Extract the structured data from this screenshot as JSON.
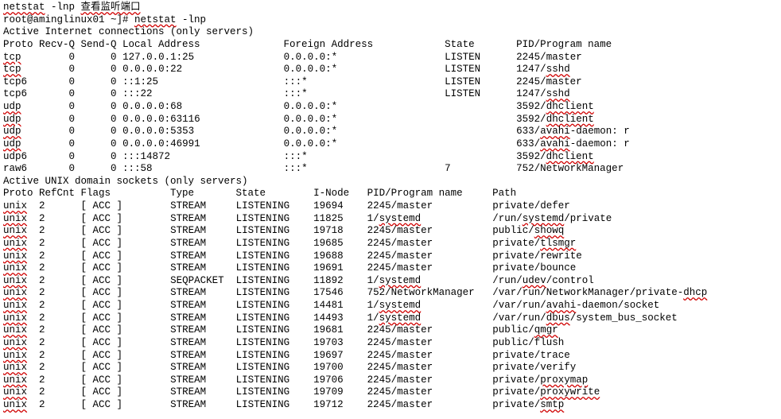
{
  "top_line_prefix": "netstat",
  "top_line_cmd": " -lnp ",
  "top_line_cn": "查看监听端口",
  "prompt_prefix": "root@aminglinux01 ~]# ",
  "prompt_cmd_prefix": "netstat",
  "prompt_cmd_rest": " -lnp",
  "inet_header": "Active Internet connections (only servers)",
  "inet_cols": {
    "proto": "Proto",
    "recvq": "Recv-Q",
    "sendq": "Send-Q",
    "local": "Local Address",
    "foreign": "Foreign Address",
    "state": "State",
    "pidprog": "PID/Program name"
  },
  "inet_rows": [
    {
      "proto": "tcp",
      "proto_err": true,
      "recvq": "0",
      "sendq": "0",
      "local": "127.0.0.1:25",
      "foreign": "0.0.0.0:*",
      "state": "LISTEN",
      "pid": "2245/",
      "prog": "master",
      "prog_err": false
    },
    {
      "proto": "tcp",
      "proto_err": true,
      "recvq": "0",
      "sendq": "0",
      "local": "0.0.0.0:22",
      "foreign": "0.0.0.0:*",
      "state": "LISTEN",
      "pid": "1247/",
      "prog": "sshd",
      "prog_err": true
    },
    {
      "proto": "tcp6",
      "proto_err": false,
      "recvq": "0",
      "sendq": "0",
      "local": "::1:25",
      "foreign": ":::*",
      "state": "LISTEN",
      "pid": "2245/",
      "prog": "master",
      "prog_err": false
    },
    {
      "proto": "tcp6",
      "proto_err": false,
      "recvq": "0",
      "sendq": "0",
      "local": ":::22",
      "foreign": ":::*",
      "state": "LISTEN",
      "pid": "1247/",
      "prog": "sshd",
      "prog_err": true
    },
    {
      "proto": "udp",
      "proto_err": true,
      "recvq": "0",
      "sendq": "0",
      "local": "0.0.0.0:68",
      "foreign": "0.0.0.0:*",
      "state": "",
      "pid": "3592/",
      "prog": "dhclient",
      "prog_err": true
    },
    {
      "proto": "udp",
      "proto_err": true,
      "recvq": "0",
      "sendq": "0",
      "local": "0.0.0.0:63116",
      "foreign": "0.0.0.0:*",
      "state": "",
      "pid": "3592/",
      "prog": "dhclient",
      "prog_err": true
    },
    {
      "proto": "udp",
      "proto_err": true,
      "recvq": "0",
      "sendq": "0",
      "local": "0.0.0.0:5353",
      "foreign": "0.0.0.0:*",
      "state": "",
      "pid": "633/",
      "prog": "avahi",
      "prog_err": true,
      "prog_rest": "-daemon: r"
    },
    {
      "proto": "udp",
      "proto_err": true,
      "recvq": "0",
      "sendq": "0",
      "local": "0.0.0.0:46991",
      "foreign": "0.0.0.0:*",
      "state": "",
      "pid": "633/",
      "prog": "avahi",
      "prog_err": true,
      "prog_rest": "-daemon: r"
    },
    {
      "proto": "udp6",
      "proto_err": false,
      "recvq": "0",
      "sendq": "0",
      "local": ":::14872",
      "foreign": ":::*",
      "state": "",
      "pid": "3592/",
      "prog": "dhclient",
      "prog_err": true
    },
    {
      "proto": "raw6",
      "proto_err": false,
      "recvq": "0",
      "sendq": "0",
      "local": ":::58",
      "foreign": ":::*",
      "state": "7",
      "pid": "752/",
      "prog": "NetworkManager",
      "prog_err": false
    }
  ],
  "unix_header": "Active UNIX domain sockets (only servers)",
  "unix_cols": {
    "proto": "Proto",
    "refcnt": "RefCnt",
    "flags": "Flags",
    "type": "Type",
    "state": "State",
    "inode": "I-Node",
    "pidprog": "PID/Program name",
    "path": "Path"
  },
  "unix_rows": [
    {
      "proto": "unix",
      "refcnt": "2",
      "flags": "[ ACC ]",
      "type": "STREAM",
      "state": "LISTENING",
      "inode": "19694",
      "pid": "2245/",
      "prog": "master",
      "prog_err": false,
      "path_pre": "private/",
      "path_tok": "defer",
      "path_err": false,
      "path_post": ""
    },
    {
      "proto": "unix",
      "refcnt": "2",
      "flags": "[ ACC ]",
      "type": "STREAM",
      "state": "LISTENING",
      "inode": "11825",
      "pid": "1/",
      "prog": "systemd",
      "prog_err": true,
      "path_pre": "/run/",
      "path_tok": "systemd",
      "path_err": true,
      "path_post": "/private"
    },
    {
      "proto": "unix",
      "refcnt": "2",
      "flags": "[ ACC ]",
      "type": "STREAM",
      "state": "LISTENING",
      "inode": "19718",
      "pid": "2245/",
      "prog": "master",
      "prog_err": false,
      "path_pre": "public/",
      "path_tok": "showq",
      "path_err": true,
      "path_post": ""
    },
    {
      "proto": "unix",
      "refcnt": "2",
      "flags": "[ ACC ]",
      "type": "STREAM",
      "state": "LISTENING",
      "inode": "19685",
      "pid": "2245/",
      "prog": "master",
      "prog_err": false,
      "path_pre": "private/",
      "path_tok": "tlsmgr",
      "path_err": true,
      "path_post": ""
    },
    {
      "proto": "unix",
      "refcnt": "2",
      "flags": "[ ACC ]",
      "type": "STREAM",
      "state": "LISTENING",
      "inode": "19688",
      "pid": "2245/",
      "prog": "master",
      "prog_err": false,
      "path_pre": "private/",
      "path_tok": "rewrite",
      "path_err": false,
      "path_post": ""
    },
    {
      "proto": "unix",
      "refcnt": "2",
      "flags": "[ ACC ]",
      "type": "STREAM",
      "state": "LISTENING",
      "inode": "19691",
      "pid": "2245/",
      "prog": "master",
      "prog_err": false,
      "path_pre": "private/",
      "path_tok": "bounce",
      "path_err": false,
      "path_post": ""
    },
    {
      "proto": "unix",
      "refcnt": "2",
      "flags": "[ ACC ]",
      "type": "SEQPACKET",
      "state": "LISTENING",
      "inode": "11892",
      "pid": "1/",
      "prog": "systemd",
      "prog_err": true,
      "path_pre": "/run/",
      "path_tok": "udev",
      "path_err": true,
      "path_post": "/control"
    },
    {
      "proto": "unix",
      "refcnt": "2",
      "flags": "[ ACC ]",
      "type": "STREAM",
      "state": "LISTENING",
      "inode": "17546",
      "pid": "752/",
      "prog": "NetworkManager",
      "prog_err": false,
      "path_pre": "/var/run/NetworkManager/private-",
      "path_tok": "dhcp",
      "path_err": true,
      "path_post": ""
    },
    {
      "proto": "unix",
      "refcnt": "2",
      "flags": "[ ACC ]",
      "type": "STREAM",
      "state": "LISTENING",
      "inode": "14481",
      "pid": "1/",
      "prog": "systemd",
      "prog_err": true,
      "path_pre": "/var/run/",
      "path_tok": "avahi",
      "path_err": true,
      "path_post": "-daemon/socket"
    },
    {
      "proto": "unix",
      "refcnt": "2",
      "flags": "[ ACC ]",
      "type": "STREAM",
      "state": "LISTENING",
      "inode": "14493",
      "pid": "1/",
      "prog": "systemd",
      "prog_err": true,
      "path_pre": "/var/run/",
      "path_tok": "dbus",
      "path_err": true,
      "path_post": "/system_bus_socket"
    },
    {
      "proto": "unix",
      "refcnt": "2",
      "flags": "[ ACC ]",
      "type": "STREAM",
      "state": "LISTENING",
      "inode": "19681",
      "pid": "2245/",
      "prog": "master",
      "prog_err": false,
      "path_pre": "public/",
      "path_tok": "qmgr",
      "path_err": true,
      "path_post": ""
    },
    {
      "proto": "unix",
      "refcnt": "2",
      "flags": "[ ACC ]",
      "type": "STREAM",
      "state": "LISTENING",
      "inode": "19703",
      "pid": "2245/",
      "prog": "master",
      "prog_err": false,
      "path_pre": "public/",
      "path_tok": "flush",
      "path_err": false,
      "path_post": ""
    },
    {
      "proto": "unix",
      "refcnt": "2",
      "flags": "[ ACC ]",
      "type": "STREAM",
      "state": "LISTENING",
      "inode": "19697",
      "pid": "2245/",
      "prog": "master",
      "prog_err": false,
      "path_pre": "private/",
      "path_tok": "trace",
      "path_err": false,
      "path_post": ""
    },
    {
      "proto": "unix",
      "refcnt": "2",
      "flags": "[ ACC ]",
      "type": "STREAM",
      "state": "LISTENING",
      "inode": "19700",
      "pid": "2245/",
      "prog": "master",
      "prog_err": false,
      "path_pre": "private/",
      "path_tok": "verify",
      "path_err": false,
      "path_post": ""
    },
    {
      "proto": "unix",
      "refcnt": "2",
      "flags": "[ ACC ]",
      "type": "STREAM",
      "state": "LISTENING",
      "inode": "19706",
      "pid": "2245/",
      "prog": "master",
      "prog_err": false,
      "path_pre": "private/",
      "path_tok": "proxymap",
      "path_err": true,
      "path_post": ""
    },
    {
      "proto": "unix",
      "refcnt": "2",
      "flags": "[ ACC ]",
      "type": "STREAM",
      "state": "LISTENING",
      "inode": "19709",
      "pid": "2245/",
      "prog": "master",
      "prog_err": false,
      "path_pre": "private/",
      "path_tok": "proxywrite",
      "path_err": true,
      "path_post": ""
    },
    {
      "proto": "unix",
      "refcnt": "2",
      "flags": "[ ACC ]",
      "type": "STREAM",
      "state": "LISTENING",
      "inode": "19712",
      "pid": "2245/",
      "prog": "master",
      "prog_err": false,
      "path_pre": "private/",
      "path_tok": "smtp",
      "path_err": true,
      "path_post": ""
    }
  ]
}
